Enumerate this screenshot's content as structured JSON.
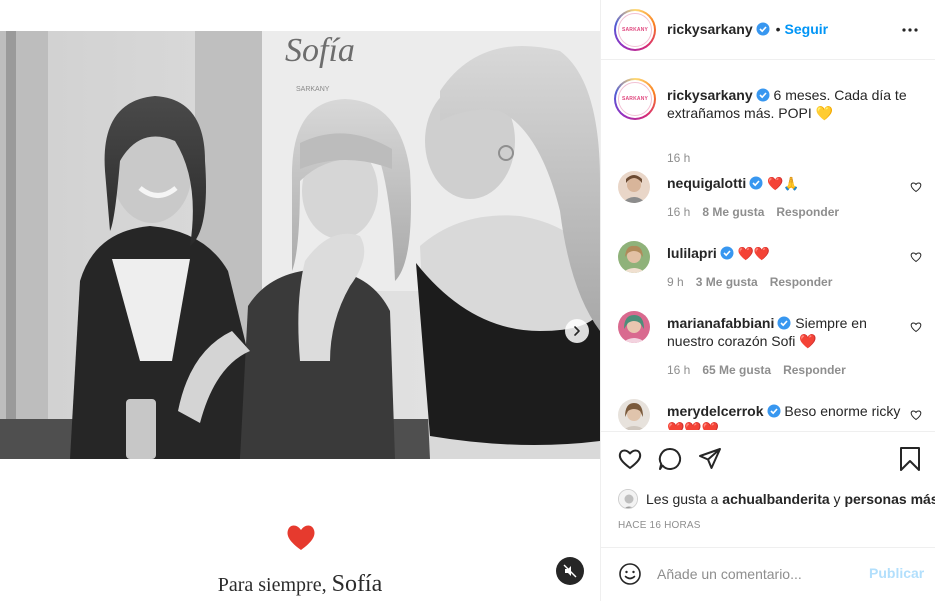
{
  "media": {
    "caption_prefix": "Para siempre,",
    "caption_name": "Sofía",
    "photo_sign_text": "Sofía",
    "photo_sign_sub": "SARKANY",
    "icons": {
      "next": "chevron-right-icon",
      "mute": "speaker-muted-icon",
      "heart": "heart-icon"
    }
  },
  "header": {
    "avatar_text": "SARKANY",
    "username": "rickysarkany",
    "separator": "•",
    "follow_label": "Seguir",
    "more_icon": "more-horizontal-icon"
  },
  "caption": {
    "username": "rickysarkany",
    "text": "6 meses. Cada día te extrañamos más. POPI 💛",
    "time": "16 h"
  },
  "comments": [
    {
      "username": "nequigalotti",
      "verified": true,
      "text": "❤️🙏",
      "time": "16 h",
      "likes": "8 Me gusta",
      "reply": "Responder"
    },
    {
      "username": "lulilapri",
      "verified": true,
      "text": "❤️❤️",
      "time": "9 h",
      "likes": "3 Me gusta",
      "reply": "Responder"
    },
    {
      "username": "marianafabbiani",
      "verified": true,
      "text": "Siempre en nuestro corazón Sofi ❤️",
      "time": "16 h",
      "likes": "65 Me gusta",
      "reply": "Responder"
    },
    {
      "username": "merydelcerrok",
      "verified": true,
      "text": "Beso enorme ricky ❤️❤️❤️"
    }
  ],
  "actions": {
    "icons": [
      "heart-icon",
      "comment-icon",
      "share-icon",
      "bookmark-icon"
    ],
    "likes_prefix": "Les gusta a",
    "likes_user": "achualbanderita",
    "likes_joiner": "y",
    "likes_suffix": "personas más",
    "post_age": "HACE 16 HORAS"
  },
  "add_comment": {
    "placeholder": "Añade un comentario...",
    "publish_label": "Publicar"
  },
  "colors": {
    "accent": "#0095f6",
    "publish_disabled": "#b2dffc",
    "heart_red": "#c1121f",
    "muted_text": "#8e8e8e"
  }
}
